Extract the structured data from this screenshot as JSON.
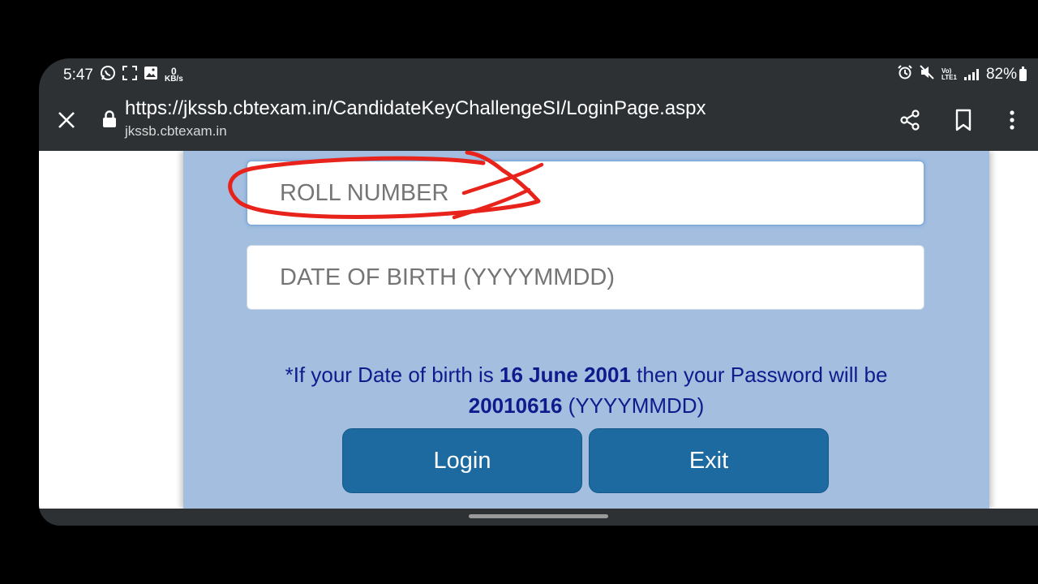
{
  "status_bar": {
    "time": "5:47",
    "net_speed_value": "0",
    "net_speed_unit": "KB/s",
    "volte_top": "Vo)",
    "volte_bottom": "LTE1",
    "battery": "82%"
  },
  "browser": {
    "url": "https://jkssb.cbtexam.in/CandidateKeyChallengeSI/LoginPage.aspx",
    "domain": "jkssb.cbtexam.in",
    "icons": [
      "close-icon",
      "lock-icon",
      "share-icon",
      "bookmark-icon",
      "more-vert-icon"
    ]
  },
  "form": {
    "roll_number_placeholder": "ROLL NUMBER",
    "dob_placeholder": "DATE OF BIRTH (YYYYMMDD)",
    "note_prefix": "*If your Date of birth is ",
    "note_date": "16 June 2001",
    "note_mid": " then your Password will be",
    "note_password": "20010616",
    "note_suffix": " (YYYYMMDD)",
    "login_label": "Login",
    "exit_label": "Exit"
  },
  "colors": {
    "panel_bg": "#a3bedf",
    "button_bg": "#1d6aa1",
    "note_text": "#101a8c",
    "annotation_red": "#e8231b",
    "chrome_bg": "#2d3134"
  }
}
